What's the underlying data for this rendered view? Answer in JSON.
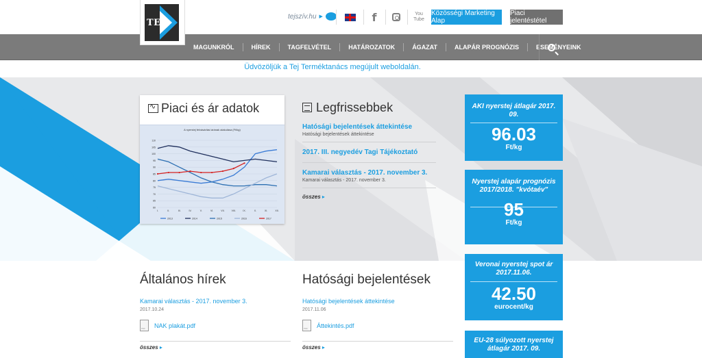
{
  "header": {
    "logo_text": "TEJ",
    "tejsziv": "tejszív.hu",
    "btn_marketing": "Közösségi Marketing Alap",
    "btn_report": "Piaci jelentéstétel",
    "youtube_label": "You Tube"
  },
  "nav": {
    "items": [
      "MAGUNKRÓL",
      "HÍREK",
      "TAGFELVÉTEL",
      "HATÁROZATOK",
      "ÁGAZAT",
      "ALAPÁR PROGNÓZIS",
      "ESEMÉNYEINK"
    ]
  },
  "welcome": "Üdvözöljük a Tej Terméktanács megújult weboldalán.",
  "market": {
    "title": "Piaci és ár adatok",
    "chart_title": "A nyerstej felvásárlási árának alakulása",
    "chart_subtitle": "(Ft/kg)"
  },
  "latest": {
    "title": "Legfrissebbek",
    "items": [
      {
        "headline": "Hatósági bejelentések áttekintése",
        "sub": "Hatósági bejelentések áttekintése"
      },
      {
        "headline": "2017. III. negyedév Tagi Tájékoztató",
        "sub": ""
      },
      {
        "headline": "Kamarai választás - 2017. november 3.",
        "sub": "Kamarai választás - 2017. november 3."
      }
    ],
    "more": "összes"
  },
  "prices": [
    {
      "label": "AKI nyerstej átlagár 2017. 09.",
      "value": "96.03",
      "unit": "Ft/kg"
    },
    {
      "label": "Nyerstej alapár prognózis 2017/2018. \"kvótaév\"",
      "value": "95",
      "unit": "Ft/kg"
    },
    {
      "label": "Veronai nyerstej spot ár 2017.11.06.",
      "value": "42.50",
      "unit": "eurocent/kg"
    },
    {
      "label": "EU-28 súlyozott nyerstej átlagár 2017. 09.",
      "value": "",
      "unit": ""
    }
  ],
  "general_news": {
    "title": "Általános hírek",
    "link": "Kamarai választás - 2017. november 3.",
    "date": "2017.10.24",
    "file": "NAK plakát.pdf",
    "more": "összes"
  },
  "authority": {
    "title": "Hatósági bejelentések",
    "link": "Hatósági bejelentések áttekintése",
    "date": "2017.11.06",
    "file": "Áttekintés.pdf",
    "more": "összes"
  },
  "colors": {
    "accent": "#1b9ee0",
    "nav": "#7b7b7b",
    "hero_bg": "#e8e9eb"
  },
  "chart_data": {
    "type": "line",
    "x": [
      "I.",
      "II.",
      "III.",
      "IV.",
      "V.",
      "VI.",
      "VII.",
      "VIII.",
      "IX.",
      "X.",
      "XI.",
      "XII."
    ],
    "ylim": [
      60,
      110
    ],
    "series": [
      {
        "name": "2013",
        "color": "#3a7bd5",
        "values": [
          80,
          81,
          80,
          79,
          78,
          79,
          81,
          84,
          90,
          100,
          102,
          103
        ]
      },
      {
        "name": "2014",
        "color": "#1f2f5c",
        "values": [
          104,
          106,
          105,
          102,
          100,
          98,
          96,
          94,
          95,
          96,
          95,
          94
        ]
      },
      {
        "name": "2015",
        "color": "#2c6fb2",
        "values": [
          96,
          94,
          90,
          86,
          82,
          79,
          77,
          76,
          76,
          77,
          77,
          76
        ]
      },
      {
        "name": "2016",
        "color": "#9fb6d8",
        "values": [
          76,
          74,
          72,
          70,
          68,
          67,
          67,
          70,
          74,
          78,
          82,
          85
        ]
      },
      {
        "name": "2017",
        "color": "#d42020",
        "values": [
          85,
          86,
          86,
          87,
          86,
          86,
          87,
          89,
          93,
          null,
          null,
          null
        ]
      }
    ]
  }
}
